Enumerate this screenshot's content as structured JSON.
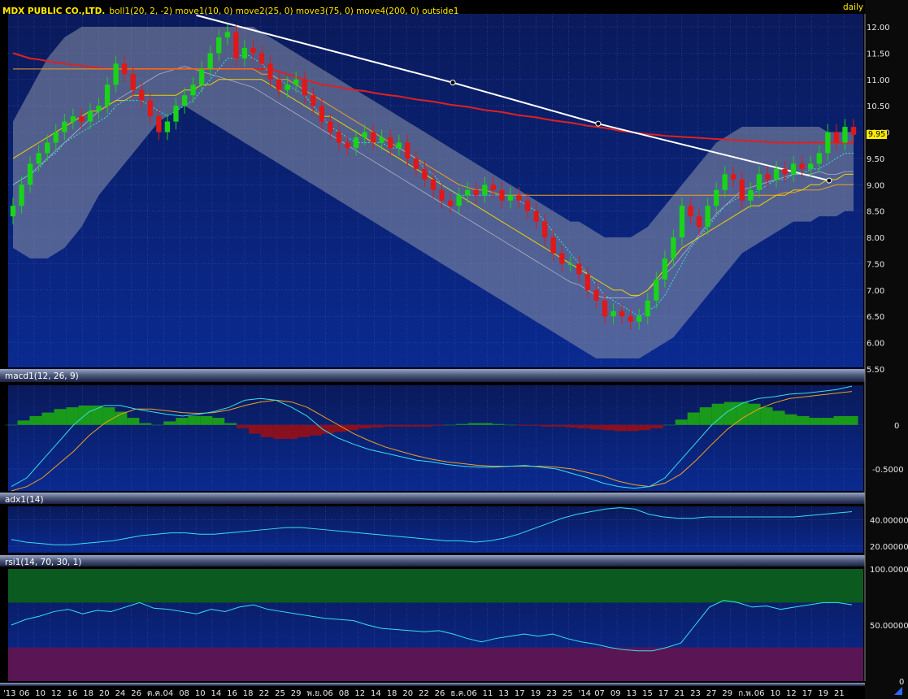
{
  "header": {
    "company": "MDX PUBLIC CO.,LTD.",
    "indicators": "boll1(20, 2, -2) move1(10, 0) move2(25, 0) move3(75, 0) move4(200, 0) outside1",
    "period": "daily"
  },
  "price_badge": "9.95",
  "macd_title": "macd1(12, 26, 9)",
  "adx_title": "adx1(14)",
  "rsi_title": "rsi1(14, 70, 30, 1)",
  "colors": {
    "background": "#0a1550",
    "grid": "#3a4cb0",
    "header_text": "#ffeb00",
    "up_candle": "#19d419",
    "down_candle": "#e01818",
    "bollinger_band": "#8c93a8",
    "ma10": "#35e0e8",
    "ma25": "#f0d000",
    "ma75": "#f0a020",
    "ma200": "#e02020",
    "trendline": "#ffffff",
    "macd_hist_pos": "#1a9a1a",
    "macd_hist_neg": "#8a1020",
    "rsi_over": "#0b5a20",
    "rsi_under": "#5a1555"
  },
  "chart_data": [
    {
      "type": "candlestick",
      "title": "MDX PUBLIC CO.,LTD.",
      "period": "daily",
      "ylim": [
        5.5,
        12.0
      ],
      "yticks": [
        "12.00",
        "11.50",
        "11.00",
        "10.50",
        "10.00",
        "9.50",
        "9.00",
        "8.50",
        "8.00",
        "7.50",
        "7.00",
        "6.50",
        "6.00",
        "5.50"
      ],
      "close": [
        8.6,
        9.0,
        9.4,
        9.6,
        9.8,
        10.0,
        10.2,
        10.3,
        10.2,
        10.4,
        10.5,
        10.9,
        11.3,
        11.1,
        10.8,
        10.6,
        10.3,
        10.0,
        10.2,
        10.5,
        10.7,
        10.9,
        11.2,
        11.5,
        11.8,
        11.9,
        11.4,
        11.6,
        11.5,
        11.3,
        11.0,
        10.8,
        10.9,
        11.0,
        10.7,
        10.5,
        10.2,
        10.0,
        9.8,
        9.7,
        9.9,
        10.0,
        9.8,
        9.9,
        9.7,
        9.8,
        9.5,
        9.3,
        9.1,
        8.9,
        8.7,
        8.6,
        8.8,
        8.9,
        8.8,
        9.0,
        8.9,
        8.7,
        8.8,
        8.7,
        8.5,
        8.3,
        8.0,
        7.7,
        7.5,
        7.5,
        7.3,
        7.0,
        6.8,
        6.5,
        6.6,
        6.5,
        6.4,
        6.5,
        6.8,
        7.2,
        7.6,
        8.0,
        8.6,
        8.4,
        8.2,
        8.6,
        8.9,
        9.2,
        9.1,
        8.7,
        8.9,
        9.2,
        9.1,
        9.3,
        9.2,
        9.4,
        9.3,
        9.4,
        9.6,
        10.0,
        9.8,
        10.1,
        9.95
      ],
      "ma10": [
        9.0,
        9.1,
        9.2,
        9.3,
        9.5,
        9.6,
        9.8,
        9.9,
        10.0,
        10.1,
        10.2,
        10.3,
        10.5,
        10.6,
        10.6,
        10.6,
        10.5,
        10.4,
        10.3,
        10.4,
        10.5,
        10.6,
        10.8,
        11.0,
        11.2,
        11.4,
        11.4,
        11.5,
        11.4,
        11.3,
        11.1,
        11.0,
        10.9,
        10.8,
        10.7,
        10.5,
        10.3,
        10.1,
        10.0,
        9.9,
        9.8,
        9.8,
        9.8,
        9.8,
        9.7,
        9.7,
        9.6,
        9.5,
        9.3,
        9.2,
        9.0,
        8.9,
        8.8,
        8.8,
        8.8,
        8.8,
        8.8,
        8.8,
        8.8,
        8.7,
        8.6,
        8.5,
        8.3,
        8.1,
        7.9,
        7.7,
        7.5,
        7.3,
        7.1,
        6.9,
        6.8,
        6.7,
        6.6,
        6.5,
        6.6,
        6.7,
        6.9,
        7.2,
        7.5,
        7.8,
        8.0,
        8.2,
        8.4,
        8.6,
        8.7,
        8.8,
        8.8,
        8.9,
        9.0,
        9.1,
        9.1,
        9.2,
        9.2,
        9.3,
        9.3,
        9.4,
        9.5,
        9.6,
        9.6
      ],
      "ma25": [
        9.5,
        9.6,
        9.7,
        9.8,
        9.9,
        10.0,
        10.1,
        10.2,
        10.3,
        10.4,
        10.4,
        10.5,
        10.6,
        10.6,
        10.7,
        10.7,
        10.7,
        10.7,
        10.7,
        10.7,
        10.8,
        10.8,
        10.9,
        10.9,
        11.0,
        11.0,
        11.0,
        11.0,
        11.0,
        11.0,
        10.9,
        10.8,
        10.7,
        10.6,
        10.5,
        10.4,
        10.3,
        10.3,
        10.2,
        10.1,
        10.0,
        9.9,
        9.8,
        9.7,
        9.6,
        9.5,
        9.4,
        9.3,
        9.2,
        9.1,
        9.0,
        8.9,
        8.8,
        8.7,
        8.6,
        8.5,
        8.4,
        8.3,
        8.2,
        8.1,
        8.0,
        7.9,
        7.8,
        7.7,
        7.6,
        7.5,
        7.4,
        7.3,
        7.2,
        7.1,
        7.0,
        7.0,
        6.9,
        6.9,
        7.0,
        7.2,
        7.4,
        7.6,
        7.8,
        7.9,
        8.0,
        8.1,
        8.2,
        8.3,
        8.4,
        8.5,
        8.6,
        8.6,
        8.7,
        8.8,
        8.8,
        8.9,
        8.9,
        9.0,
        9.0,
        9.1,
        9.1,
        9.2,
        9.2
      ],
      "ma75": [
        11.2,
        11.2,
        11.2,
        11.2,
        11.2,
        11.2,
        11.2,
        11.2,
        11.2,
        11.2,
        11.2,
        11.2,
        11.2,
        11.2,
        11.2,
        11.2,
        11.2,
        11.2,
        11.2,
        11.2,
        11.2,
        11.2,
        11.2,
        11.2,
        11.2,
        11.2,
        11.2,
        11.2,
        11.2,
        11.1,
        11.1,
        11.0,
        11.0,
        10.9,
        10.8,
        10.7,
        10.6,
        10.5,
        10.4,
        10.3,
        10.2,
        10.1,
        10.0,
        9.9,
        9.8,
        9.7,
        9.6,
        9.5,
        9.4,
        9.3,
        9.2,
        9.1,
        9.0,
        8.95,
        8.9,
        8.9,
        8.85,
        8.8,
        8.8,
        8.8,
        8.8,
        8.8,
        8.8,
        8.8,
        8.8,
        8.8,
        8.8,
        8.8,
        8.8,
        8.8,
        8.8,
        8.8,
        8.8,
        8.8,
        8.8,
        8.8,
        8.8,
        8.8,
        8.8,
        8.8,
        8.8,
        8.8,
        8.8,
        8.8,
        8.8,
        8.8,
        8.8,
        8.8,
        8.8,
        8.8,
        8.85,
        8.85,
        8.9,
        8.9,
        8.9,
        8.95,
        9.0,
        9.0,
        9.0
      ],
      "ma200": [
        11.5,
        11.45,
        11.4,
        11.38,
        11.35,
        11.32,
        11.3,
        11.28,
        11.26,
        11.24,
        11.22,
        11.2,
        11.2,
        11.2,
        11.2,
        11.2,
        11.2,
        11.2,
        11.2,
        11.2,
        11.2,
        11.2,
        11.2,
        11.2,
        11.2,
        11.2,
        11.2,
        11.2,
        11.2,
        11.2,
        11.2,
        11.15,
        11.1,
        11.05,
        11.0,
        10.95,
        10.9,
        10.88,
        10.85,
        10.82,
        10.8,
        10.78,
        10.75,
        10.72,
        10.7,
        10.68,
        10.65,
        10.62,
        10.6,
        10.58,
        10.55,
        10.52,
        10.5,
        10.48,
        10.45,
        10.42,
        10.4,
        10.38,
        10.35,
        10.32,
        10.3,
        10.28,
        10.25,
        10.22,
        10.2,
        10.18,
        10.15,
        10.12,
        10.1,
        10.08,
        10.05,
        10.02,
        10.0,
        9.98,
        9.96,
        9.95,
        9.93,
        9.92,
        9.91,
        9.9,
        9.89,
        9.88,
        9.87,
        9.86,
        9.85,
        9.84,
        9.83,
        9.82,
        9.81,
        9.8,
        9.8,
        9.8,
        9.8,
        9.8,
        9.8,
        9.8,
        9.8,
        9.8,
        9.8
      ],
      "boll_upper": [
        10.2,
        10.5,
        10.8,
        11.1,
        11.4,
        11.6,
        11.8,
        11.9,
        12.0,
        12.0,
        12.0,
        12.0,
        12.0,
        12.0,
        12.0,
        12.0,
        12.0,
        12.0,
        12.0,
        12.0,
        12.0,
        12.0,
        12.0,
        12.0,
        12.0,
        12.0,
        12.0,
        12.0,
        12.0,
        11.9,
        11.8,
        11.7,
        11.6,
        11.5,
        11.4,
        11.3,
        11.2,
        11.1,
        11.0,
        10.9,
        10.8,
        10.7,
        10.6,
        10.5,
        10.4,
        10.3,
        10.2,
        10.1,
        10.0,
        9.9,
        9.8,
        9.7,
        9.6,
        9.5,
        9.4,
        9.3,
        9.2,
        9.1,
        9.0,
        8.9,
        8.8,
        8.7,
        8.6,
        8.5,
        8.4,
        8.3,
        8.3,
        8.2,
        8.1,
        8.0,
        8.0,
        8.0,
        8.0,
        8.1,
        8.2,
        8.4,
        8.6,
        8.8,
        9.0,
        9.2,
        9.4,
        9.6,
        9.8,
        9.9,
        10.0,
        10.1,
        10.1,
        10.1,
        10.1,
        10.1,
        10.1,
        10.1,
        10.1,
        10.1,
        10.1,
        10.0,
        10.0,
        10.0,
        10.0
      ],
      "boll_lower": [
        7.8,
        7.7,
        7.6,
        7.6,
        7.6,
        7.7,
        7.8,
        8.0,
        8.2,
        8.5,
        8.8,
        9.0,
        9.2,
        9.4,
        9.6,
        9.8,
        10.0,
        10.2,
        10.3,
        10.4,
        10.5,
        10.4,
        10.3,
        10.2,
        10.1,
        10.0,
        9.9,
        9.8,
        9.7,
        9.6,
        9.5,
        9.4,
        9.3,
        9.2,
        9.1,
        9.0,
        8.9,
        8.8,
        8.7,
        8.6,
        8.5,
        8.4,
        8.3,
        8.2,
        8.1,
        8.0,
        7.9,
        7.8,
        7.7,
        7.6,
        7.5,
        7.4,
        7.3,
        7.2,
        7.1,
        7.0,
        6.9,
        6.8,
        6.7,
        6.6,
        6.5,
        6.4,
        6.3,
        6.2,
        6.1,
        6.0,
        5.9,
        5.8,
        5.7,
        5.7,
        5.7,
        5.7,
        5.7,
        5.7,
        5.8,
        5.9,
        6.0,
        6.1,
        6.3,
        6.5,
        6.7,
        6.9,
        7.1,
        7.3,
        7.5,
        7.7,
        7.8,
        7.9,
        8.0,
        8.1,
        8.2,
        8.3,
        8.3,
        8.3,
        8.4,
        8.4,
        8.4,
        8.5,
        8.5
      ],
      "trendline": [
        [
          0.22,
          12.22
        ],
        [
          0.52,
          10.94
        ],
        [
          0.69,
          10.16
        ],
        [
          0.96,
          9.08
        ]
      ]
    },
    {
      "type": "macd",
      "title": "macd1(12, 26, 9)",
      "yticks": [
        "0",
        "-0.5000"
      ],
      "ylim": [
        -0.75,
        0.45
      ],
      "hist": [
        0.0,
        0.05,
        0.1,
        0.14,
        0.18,
        0.2,
        0.22,
        0.22,
        0.2,
        0.15,
        0.08,
        0.02,
        0.0,
        0.04,
        0.08,
        0.1,
        0.1,
        0.08,
        0.02,
        -0.04,
        -0.1,
        -0.14,
        -0.16,
        -0.16,
        -0.14,
        -0.12,
        -0.1,
        -0.08,
        -0.06,
        -0.04,
        -0.03,
        -0.02,
        -0.02,
        -0.02,
        -0.02,
        -0.01,
        0.0,
        0.01,
        0.02,
        0.02,
        0.01,
        0.0,
        -0.01,
        -0.01,
        -0.02,
        -0.02,
        -0.03,
        -0.04,
        -0.05,
        -0.06,
        -0.07,
        -0.07,
        -0.06,
        -0.04,
        0.0,
        0.06,
        0.14,
        0.2,
        0.24,
        0.26,
        0.26,
        0.24,
        0.2,
        0.16,
        0.12,
        0.1,
        0.08,
        0.08,
        0.1,
        0.1
      ],
      "macd": [
        -0.7,
        -0.6,
        -0.4,
        -0.2,
        0.0,
        0.15,
        0.22,
        0.22,
        0.18,
        0.15,
        0.12,
        0.1,
        0.12,
        0.15,
        0.2,
        0.28,
        0.3,
        0.28,
        0.2,
        0.1,
        -0.05,
        -0.15,
        -0.22,
        -0.28,
        -0.32,
        -0.36,
        -0.4,
        -0.42,
        -0.45,
        -0.47,
        -0.48,
        -0.48,
        -0.47,
        -0.46,
        -0.48,
        -0.5,
        -0.55,
        -0.6,
        -0.66,
        -0.7,
        -0.72,
        -0.7,
        -0.6,
        -0.4,
        -0.2,
        0.0,
        0.15,
        0.25,
        0.3,
        0.32,
        0.35,
        0.36,
        0.38,
        0.4,
        0.44
      ],
      "signal": [
        -0.75,
        -0.7,
        -0.6,
        -0.45,
        -0.3,
        -0.12,
        0.02,
        0.12,
        0.18,
        0.18,
        0.16,
        0.14,
        0.13,
        0.14,
        0.17,
        0.22,
        0.26,
        0.28,
        0.26,
        0.2,
        0.1,
        0.0,
        -0.1,
        -0.18,
        -0.25,
        -0.3,
        -0.35,
        -0.39,
        -0.42,
        -0.44,
        -0.46,
        -0.47,
        -0.47,
        -0.47,
        -0.47,
        -0.48,
        -0.5,
        -0.54,
        -0.58,
        -0.64,
        -0.68,
        -0.7,
        -0.66,
        -0.56,
        -0.4,
        -0.22,
        -0.05,
        0.08,
        0.18,
        0.25,
        0.3,
        0.32,
        0.34,
        0.36,
        0.38
      ]
    },
    {
      "type": "line",
      "title": "adx1(14)",
      "yticks": [
        "40.00000",
        "20.00000"
      ],
      "ylim": [
        15,
        50
      ],
      "values": [
        25,
        23,
        22,
        21,
        21,
        22,
        23,
        24,
        26,
        28,
        29,
        30,
        30,
        29,
        29,
        30,
        31,
        32,
        33,
        34,
        34,
        33,
        32,
        31,
        30,
        29,
        28,
        27,
        26,
        25,
        24,
        24,
        23,
        24,
        26,
        29,
        33,
        37,
        41,
        44,
        46,
        48,
        49,
        48,
        44,
        42,
        41,
        41,
        42,
        42,
        42,
        42,
        42,
        42,
        42,
        43,
        44,
        45,
        46
      ]
    },
    {
      "type": "line",
      "title": "rsi1(14, 70, 30, 1)",
      "yticks": [
        "100.0000",
        "50.00000",
        "0"
      ],
      "ylim": [
        0,
        100
      ],
      "overbought": 70,
      "oversold": 30,
      "values": [
        50,
        55,
        58,
        62,
        64,
        60,
        63,
        62,
        66,
        70,
        65,
        64,
        62,
        60,
        64,
        62,
        66,
        68,
        64,
        62,
        60,
        58,
        56,
        55,
        54,
        50,
        47,
        46,
        45,
        44,
        45,
        42,
        38,
        35,
        38,
        40,
        42,
        40,
        42,
        38,
        35,
        33,
        30,
        28,
        27,
        27,
        30,
        34,
        50,
        66,
        72,
        70,
        66,
        67,
        64,
        66,
        68,
        70,
        70,
        68
      ]
    }
  ],
  "x_labels": [
    "'13",
    "06",
    "10",
    "12",
    "16",
    "18",
    "20",
    "24",
    "26",
    "ต.ค.",
    "04",
    "08",
    "10",
    "14",
    "16",
    "18",
    "22",
    "25",
    "29",
    "พ.ย.",
    "06",
    "08",
    "12",
    "14",
    "18",
    "20",
    "22",
    "26",
    "ธ.ค.",
    "06",
    "11",
    "13",
    "17",
    "19",
    "23",
    "25",
    "'14",
    "07",
    "09",
    "13",
    "15",
    "17",
    "21",
    "23",
    "27",
    "29",
    "ก.พ.",
    "06",
    "10",
    "12",
    "17",
    "19",
    "21"
  ]
}
